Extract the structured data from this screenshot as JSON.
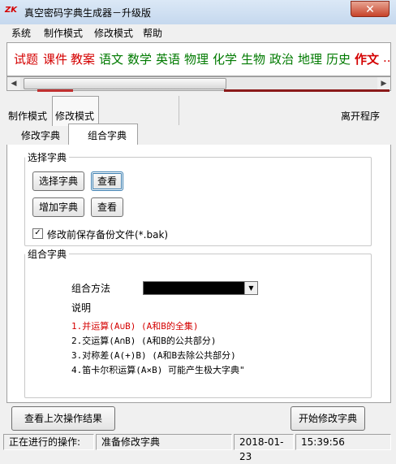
{
  "window": {
    "icon_text": "ZK",
    "title": "真空密码字典生成器－升级版",
    "close_glyph": "✕"
  },
  "menu": [
    "系统",
    "制作模式",
    "修改模式",
    "帮助"
  ],
  "subjects": [
    {
      "label": "试题",
      "color": "#d40000"
    },
    {
      "label": "课件",
      "color": "#d40000"
    },
    {
      "label": "教案",
      "color": "#d40000"
    },
    {
      "label": "语文",
      "color": "#007a00"
    },
    {
      "label": "数学",
      "color": "#007a00"
    },
    {
      "label": "英语",
      "color": "#007a00"
    },
    {
      "label": "物理",
      "color": "#007a00"
    },
    {
      "label": "化学",
      "color": "#007a00"
    },
    {
      "label": "生物",
      "color": "#007a00"
    },
    {
      "label": "政治",
      "color": "#007a00"
    },
    {
      "label": "地理",
      "color": "#007a00"
    },
    {
      "label": "历史",
      "color": "#007a00"
    },
    {
      "label": "作文",
      "color": "#d40000"
    },
    {
      "label": "...",
      "color": "#d40000"
    }
  ],
  "modes": {
    "make": "制作模式",
    "modify": "修改模式",
    "exit": "离开程序"
  },
  "tabs": {
    "modify_dict": "修改字典",
    "combine_dict": "组合字典"
  },
  "select_group": {
    "legend": "选择字典",
    "select_btn": "选择字典",
    "view_btn1": "查看",
    "add_btn": "增加字典",
    "view_btn2": "查看",
    "backup_label": "修改前保存备份文件(*.bak)",
    "backup_checked": "✓"
  },
  "combine_group": {
    "legend": "组合字典",
    "method_label": "组合方法",
    "combo_arrow": "▼",
    "desc_title": "说明",
    "items": [
      {
        "text": "1.并运算(A∪B) (A和B的全集)",
        "color": "#d40000"
      },
      {
        "text": "2.交运算(A∩B) (A和B的公共部分)",
        "color": "#000000"
      },
      {
        "text": "3.对称差(A(+)B) (A和B去除公共部分)",
        "color": "#000000"
      },
      {
        "text": "4.笛卡尔积运算(A×B) 可能产生极大字典\"",
        "color": "#000000"
      }
    ]
  },
  "bottom": {
    "last_result_btn": "查看上次操作结果",
    "start_btn": "开始修改字典"
  },
  "status": {
    "label": "正在进行的操作:",
    "operation": "准备修改字典",
    "date": "2018-01-23",
    "time": "15:39:56"
  }
}
